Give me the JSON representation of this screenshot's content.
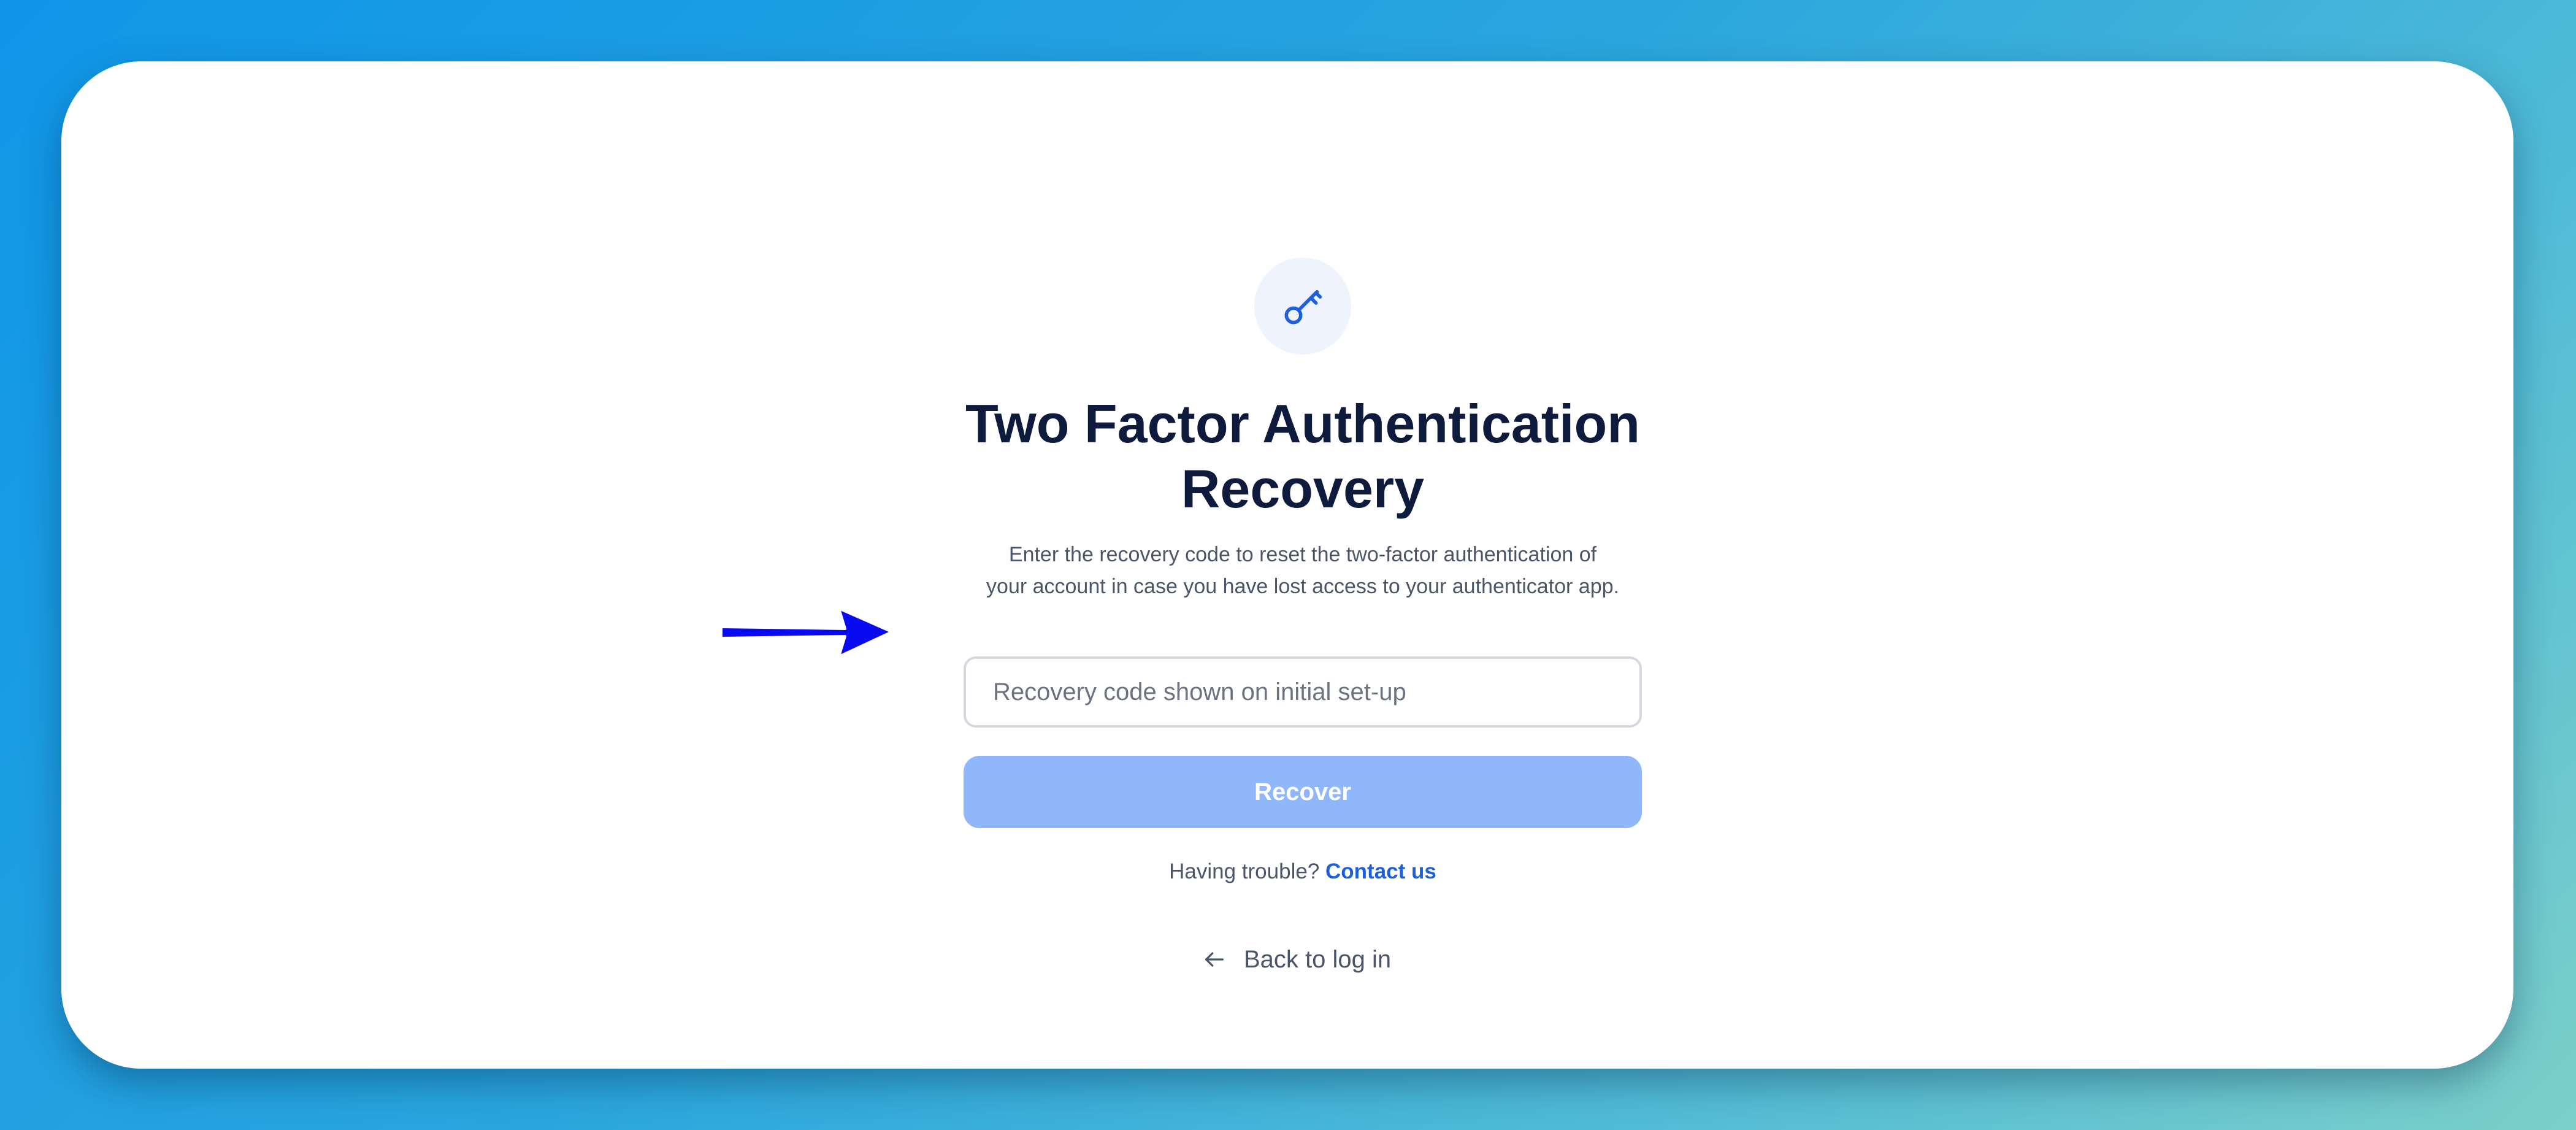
{
  "page": {
    "title_line1": "Two Factor Authentication",
    "title_line2": "Recovery",
    "description_line1": "Enter the recovery code to reset the two-factor authentication of",
    "description_line2": "your account in case you have lost access to your authenticator app.",
    "icon": "key-icon"
  },
  "form": {
    "recovery_placeholder": "Recovery code shown on initial set-up",
    "recovery_value": "",
    "submit_label": "Recover"
  },
  "help": {
    "prompt": "Having trouble?",
    "contact_label": "Contact us"
  },
  "nav": {
    "back_label": "Back to log in",
    "back_icon": "arrow-left-icon"
  },
  "annotation": {
    "icon": "pointer-arrow-icon",
    "color": "#0a0af0"
  },
  "colors": {
    "accent": "#1d5fdc",
    "button_disabled": "#91b7fb",
    "heading": "#0f1b3d",
    "badge_bg": "#eef3fd"
  }
}
